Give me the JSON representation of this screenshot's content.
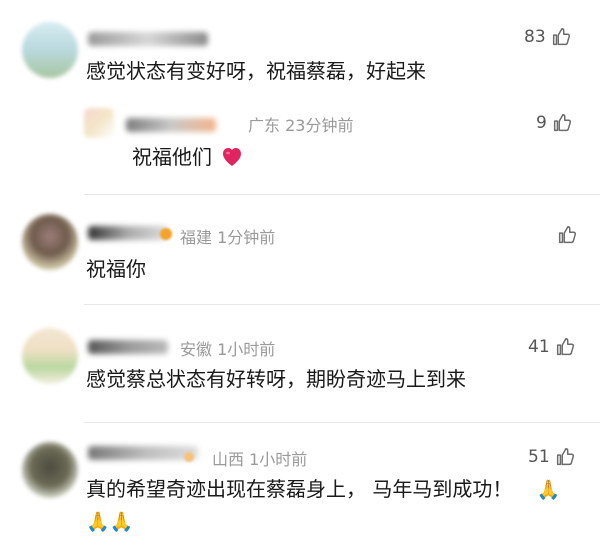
{
  "comments": [
    {
      "text": "感觉状态有变好呀，祝福蔡磊，好起来",
      "likes": "83",
      "reply": {
        "meta": "广东 23分钟前",
        "text": "祝福他们",
        "likes": "9",
        "emoji": "heart"
      }
    },
    {
      "meta": "福建 1分钟前",
      "text": "祝福你",
      "likes": ""
    },
    {
      "meta": "安徽 1小时前",
      "text": "感觉蔡总状态有好转呀，期盼奇迹马上到来",
      "likes": "41"
    },
    {
      "meta": "山西 1小时前",
      "text": "真的希望奇迹出现在蔡磊身上， 马年马到成功！",
      "text_emoji": "🙏",
      "second_line_emoji": "🙏🙏",
      "likes": "51"
    }
  ],
  "icons": {
    "like": "thumbs-up-outline-icon",
    "heart": "red-heart-emoji"
  },
  "colors": {
    "meta": "#9a9a9a",
    "text": "#1a1a1a",
    "heart": "#e0245e",
    "divider": "#e6e6e6"
  }
}
